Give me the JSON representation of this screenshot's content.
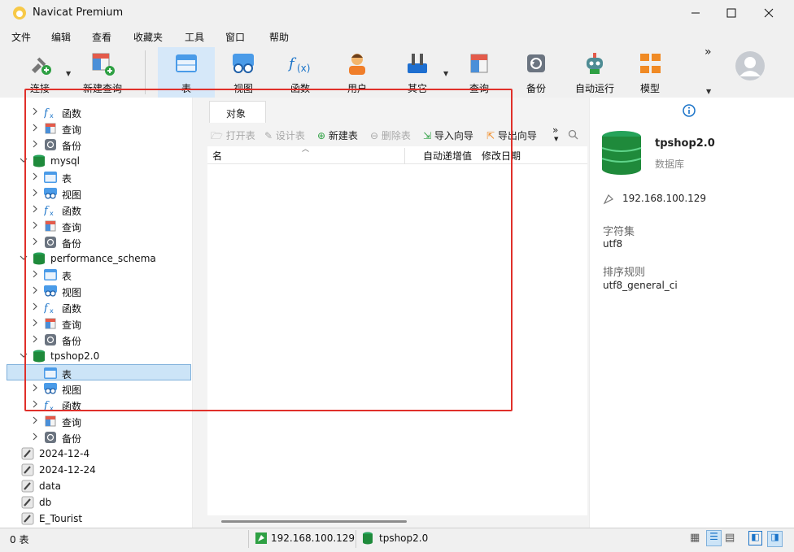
{
  "window": {
    "title": "Navicat Premium"
  },
  "menu": [
    "文件",
    "编辑",
    "查看",
    "收藏夹",
    "工具",
    "窗口",
    "帮助"
  ],
  "toolbar": {
    "connect": "连接",
    "new_query": "新建查询",
    "table": "表",
    "view": "视图",
    "function": "函数",
    "user": "用户",
    "other": "其它",
    "query": "查询",
    "backup": "备份",
    "automation": "自动运行",
    "model": "模型",
    "more": "»"
  },
  "tree": {
    "rows": [
      {
        "label": "函数",
        "icon": "function-icon"
      },
      {
        "label": "查询",
        "icon": "query-icon"
      },
      {
        "label": "备份",
        "icon": "backup-icon"
      },
      {
        "label": "mysql",
        "icon": "database-icon"
      },
      {
        "label": "表",
        "icon": "table-icon"
      },
      {
        "label": "视图",
        "icon": "view-icon"
      },
      {
        "label": "函数",
        "icon": "function-icon"
      },
      {
        "label": "查询",
        "icon": "query-icon"
      },
      {
        "label": "备份",
        "icon": "backup-icon"
      },
      {
        "label": "performance_schema",
        "icon": "database-icon"
      },
      {
        "label": "表",
        "icon": "table-icon"
      },
      {
        "label": "视图",
        "icon": "view-icon"
      },
      {
        "label": "函数",
        "icon": "function-icon"
      },
      {
        "label": "查询",
        "icon": "query-icon"
      },
      {
        "label": "备份",
        "icon": "backup-icon"
      },
      {
        "label": "tpshop2.0",
        "icon": "database-icon"
      },
      {
        "label": "表",
        "icon": "table-icon"
      },
      {
        "label": "视图",
        "icon": "view-icon"
      },
      {
        "label": "函数",
        "icon": "function-icon"
      },
      {
        "label": "查询",
        "icon": "query-icon"
      },
      {
        "label": "备份",
        "icon": "backup-icon"
      },
      {
        "label": "2024-12-4",
        "icon": "connection-icon"
      },
      {
        "label": "2024-12-24",
        "icon": "connection-icon"
      },
      {
        "label": "data",
        "icon": "connection-icon"
      },
      {
        "label": "db",
        "icon": "connection-icon"
      },
      {
        "label": "E_Tourist",
        "icon": "connection-icon"
      }
    ]
  },
  "objects": {
    "tab": "对象",
    "open_table": "打开表",
    "design_table": "设计表",
    "new_table": "新建表",
    "delete_table": "删除表",
    "import_wizard": "导入向导",
    "export_wizard": "导出向导",
    "more": "»",
    "columns": [
      "名",
      "自动递增值",
      "修改日期"
    ]
  },
  "info": {
    "db_name": "tpshop2.0",
    "db_type": "数据库",
    "host": "192.168.100.129",
    "charset_label": "字符集",
    "charset_value": "utf8",
    "collation_label": "排序规则",
    "collation_value": "utf8_general_ci"
  },
  "status": {
    "count": "0 表",
    "host": "192.168.100.129",
    "db": "tpshop2.0"
  },
  "colors": {
    "accent": "#1f8a3b",
    "highlight": "#e0302a",
    "blue": "#1a73c8"
  }
}
